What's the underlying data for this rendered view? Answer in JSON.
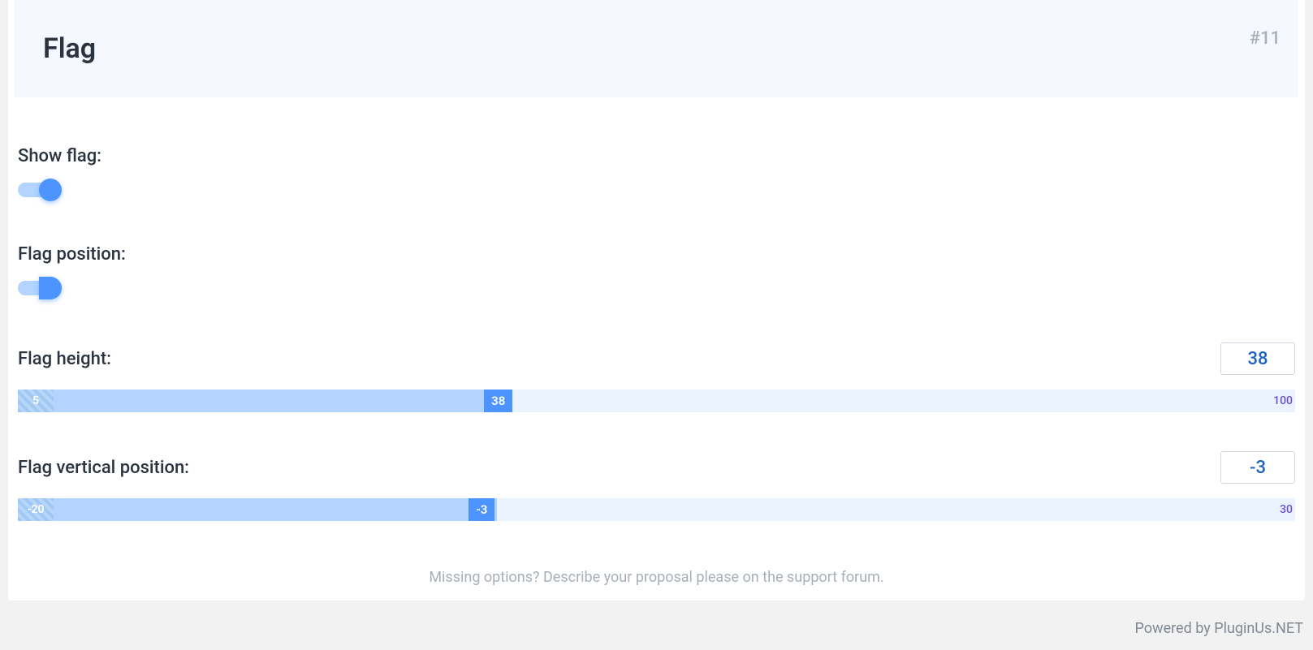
{
  "header": {
    "title": "Flag",
    "id": "#11"
  },
  "fields": {
    "show_flag": {
      "label": "Show flag:",
      "value": true
    },
    "flag_position": {
      "label": "Flag position:",
      "value": true
    },
    "flag_height": {
      "label": "Flag height:",
      "value": "38",
      "min": "5",
      "max": "100",
      "handle_left_percent": 36.5,
      "fill_percent": 37.5
    },
    "flag_vertical_position": {
      "label": "Flag vertical position:",
      "value": "-3",
      "min": "-20",
      "max": "30",
      "handle_left_percent": 35.3,
      "fill_percent": 37.5
    }
  },
  "footer": {
    "message": "Missing options? Describe your proposal please on the support forum.",
    "credit": "Powered by PluginUs.NET"
  }
}
